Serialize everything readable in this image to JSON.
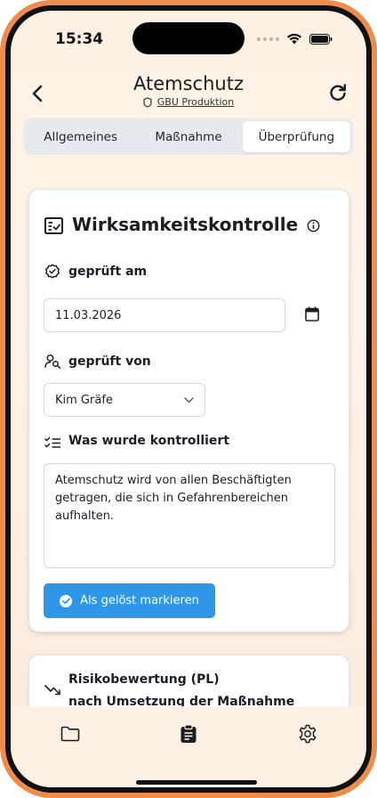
{
  "status_bar": {
    "time": "15:34"
  },
  "header": {
    "title": "Atemschutz",
    "subtitle": "GBU Produktion",
    "back_icon": "chevron-left-icon",
    "refresh_icon": "refresh-icon"
  },
  "tabs": [
    {
      "label": "Allgemeines",
      "active": false
    },
    {
      "label": "Maßnahme",
      "active": false
    },
    {
      "label": "Überprüfung",
      "active": true
    }
  ],
  "card": {
    "title": "Wirksamkeitskontrolle",
    "checked_on": {
      "label": "geprüft am",
      "value": "11.03.2026"
    },
    "checked_by": {
      "label": "geprüft von",
      "value": "Kim Gräfe"
    },
    "what_checked": {
      "label": "Was wurde kontrolliert",
      "value": "Atemschutz wird von allen Beschäftigten getragen, die sich in Gefahrenbereichen aufhalten."
    },
    "resolve_button": "Als gelöst markieren"
  },
  "card2": {
    "title_line1": "Risikobewertung (PL)",
    "title_line2": "nach Umsetzung der Maßnahme"
  },
  "tabbar": {
    "items": [
      "folder-icon",
      "clipboard-icon",
      "gear-icon"
    ]
  },
  "colors": {
    "accent": "#2f96e8",
    "frame": "#ef8c4a",
    "background": "#fdf1e4"
  }
}
